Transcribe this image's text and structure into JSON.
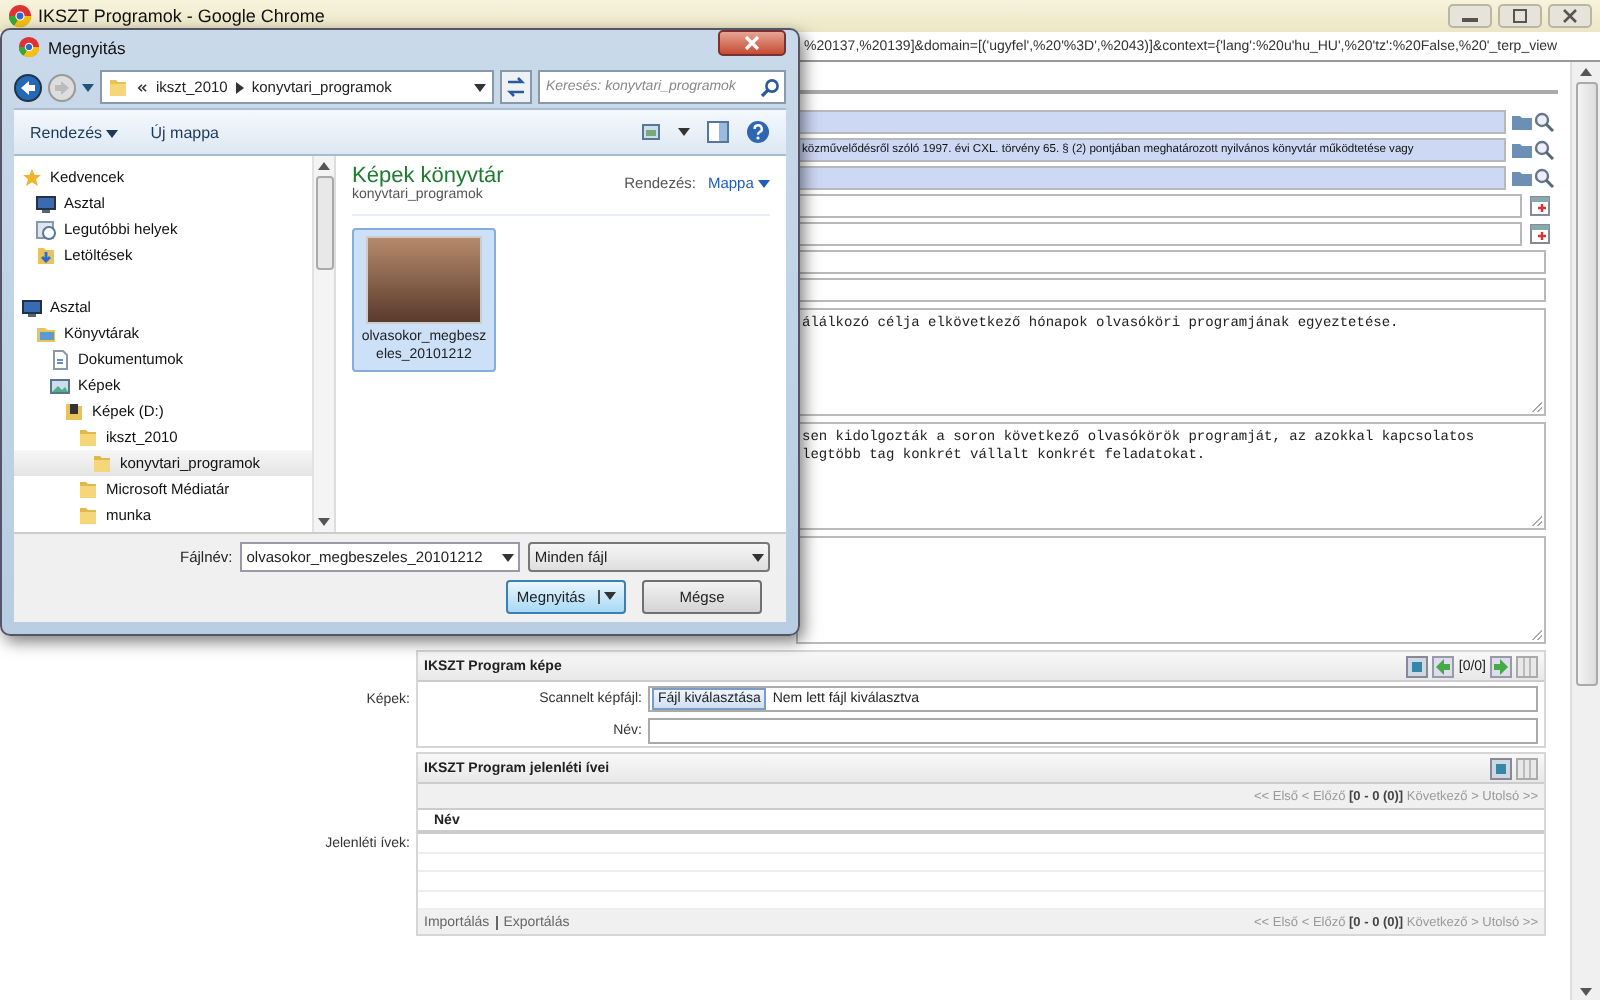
{
  "browser": {
    "title": "IKSZT Programok - Google Chrome",
    "url": "%20137,%20139]&domain=[('ugyfel',%20'%3D',%2043)]&context={'lang':%20u'hu_HU',%20'tz':%20False,%20'_terp_view"
  },
  "fields": [
    {
      "kind": "lookup"
    },
    {
      "kind": "lookup",
      "value": "közművelődésről szóló 1997. évi CXL. törvény 65. § (2) pontjában meghatározott nyilvános könyvtár működtetése vagy"
    },
    {
      "kind": "lookup"
    },
    {
      "kind": "date"
    },
    {
      "kind": "date"
    },
    {
      "kind": "text"
    },
    {
      "kind": "text"
    }
  ],
  "notes": [
    {
      "kind": "textarea",
      "lines": [
        "álálkozó célja elkövetkező hónapok olvasóköri programjának egyeztetése."
      ]
    },
    {
      "kind": "textarea",
      "lines": [
        "sen kidolgozták a soron következő olvasókörök programját, az azokkal kapcsolatos",
        "legtöbb tag konkrét vállalt konkrét feladatokat."
      ]
    },
    {
      "kind": "textarea"
    }
  ],
  "images": {
    "label": "Képek:",
    "title": "IKSZT Program képe",
    "counter": "[0/0]",
    "file_label": "Scannelt képfájl:",
    "file_button": "Fájl kiválasztása",
    "file_status": "Nem lett fájl kiválasztva",
    "name_label": "Név:"
  },
  "attendance": {
    "label": "Jelenléti ívek:",
    "title": "IKSZT Program jelenléti ívei",
    "pager": "<< Első < Előző **[0 - 0 (0)]** Következő > Utolsó >>",
    "column": "Név",
    "links": [
      "Importálás",
      "Exportálás"
    ],
    "footer_pager": "<< Első < Előző **[0 - 0 (0)]** Következő > Utolsó >>"
  },
  "dialog": {
    "title": "Megnyitás",
    "path": [
      "ikszt_2010",
      "konyvtari_programok"
    ],
    "search_placeholder": "Keresés: konyvtari_programok",
    "toolbar": [
      "Rendezés",
      "Új mappa"
    ],
    "tree": [
      {
        "label": "Kedvencek",
        "kind": "star",
        "selected": false,
        "children": [
          {
            "label": "Asztal",
            "kind": "desktop",
            "selected": false
          },
          {
            "label": "Legutóbbi helyek",
            "kind": "recent",
            "selected": false
          },
          {
            "label": "Letöltések",
            "kind": "downloads",
            "selected": false
          }
        ]
      },
      {
        "label": "Asztal",
        "kind": "desktop",
        "selected": false,
        "children": [
          {
            "label": "Könyvtárak",
            "kind": "library",
            "selected": false,
            "children": [
              {
                "label": "Dokumentumok",
                "kind": "document",
                "selected": false
              },
              {
                "label": "Képek",
                "kind": "pictures",
                "selected": false,
                "children": [
                  {
                    "label": "Képek (D:)",
                    "kind": "drive",
                    "selected": false,
                    "children": [
                      {
                        "label": "ikszt_2010",
                        "kind": "folder",
                        "selected": false,
                        "children": [
                          {
                            "label": "konyvtari_programok",
                            "kind": "folder",
                            "selected": true
                          }
                        ]
                      },
                      {
                        "label": "Microsoft Médiatár",
                        "kind": "folder",
                        "selected": false
                      },
                      {
                        "label": "munka",
                        "kind": "folder",
                        "selected": false
                      }
                    ]
                  }
                ]
              }
            ]
          }
        ]
      }
    ],
    "library_title": "Képek könyvtár",
    "library_subtitle": "konyvtari_programok",
    "arrange_label": "Rendezés:",
    "arrange_value": "Mappa",
    "files": [
      {
        "name": "olvasokor_megbeszeles_20101212",
        "selected": true
      }
    ],
    "filename_label": "Fájlnév:",
    "filename": "olvasokor_megbeszeles_20101212",
    "filter": "Minden fájl",
    "buttons": [
      "Megnyitás",
      "Mégse"
    ]
  }
}
